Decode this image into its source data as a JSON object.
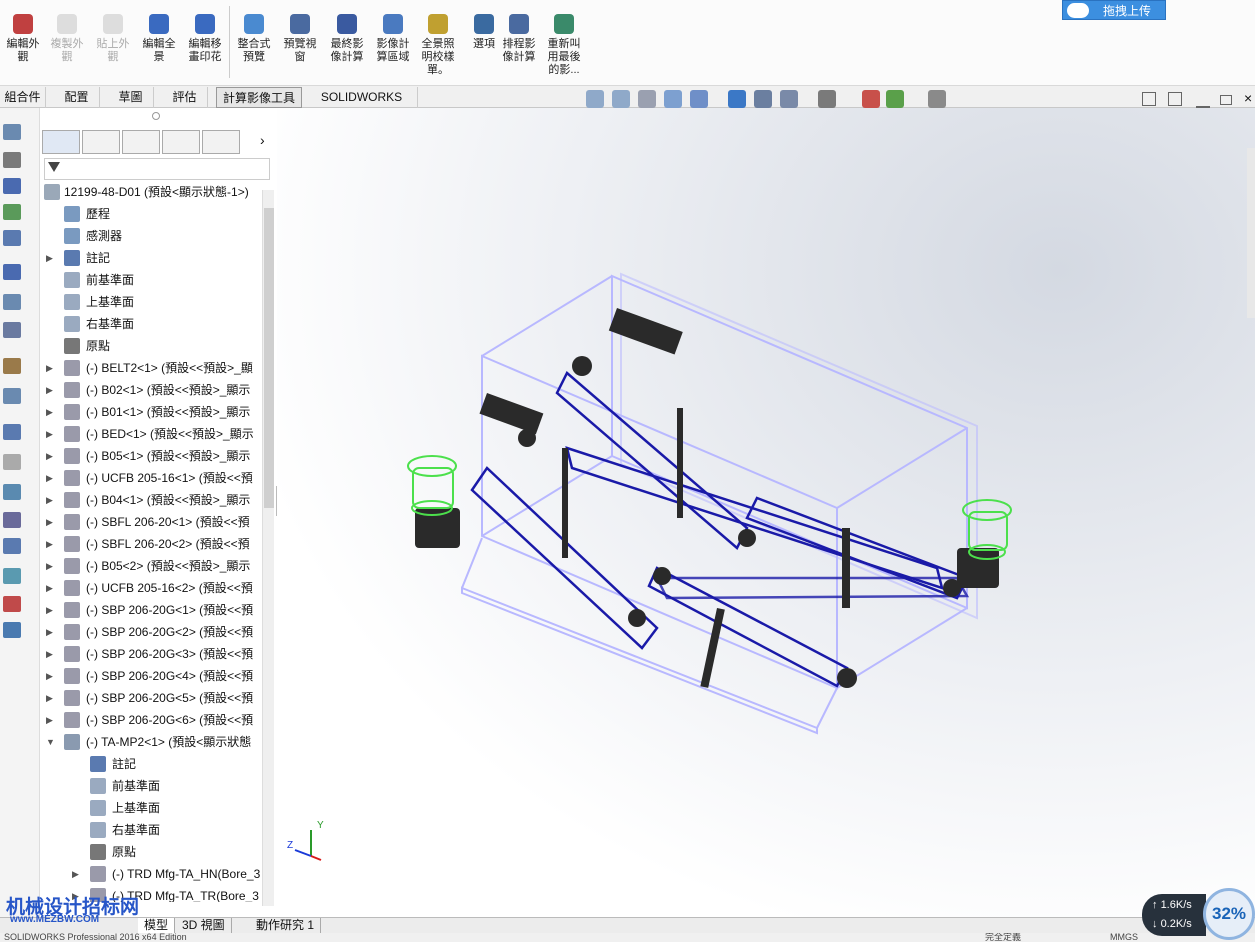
{
  "ribbon": {
    "buttons": [
      {
        "label": "編輯外觀",
        "icon": "edit-appearance-icon",
        "enabled": true
      },
      {
        "label": "複製外觀",
        "icon": "copy-appearance-icon",
        "enabled": false
      },
      {
        "label": "貼上外觀",
        "icon": "paste-appearance-icon",
        "enabled": false
      },
      {
        "label": "編輯全景",
        "icon": "edit-scene-icon",
        "enabled": true
      },
      {
        "label": "編輯移畫印花",
        "icon": "edit-decal-icon",
        "enabled": true
      },
      {
        "label": "整合式預覽",
        "icon": "integrated-preview-icon",
        "enabled": true
      },
      {
        "label": "預覽視窗",
        "icon": "preview-window-icon",
        "enabled": true
      },
      {
        "label": "最終影像計算",
        "icon": "final-render-icon",
        "enabled": true
      },
      {
        "label": "影像計算區域",
        "icon": "render-region-icon",
        "enabled": true
      },
      {
        "label": "全景照明校樣單。",
        "icon": "scene-illumination-proof-icon",
        "enabled": true
      },
      {
        "label": "選項",
        "icon": "options-icon",
        "enabled": true
      },
      {
        "label": "排程影像計算",
        "icon": "schedule-render-icon",
        "enabled": true
      },
      {
        "label": "重新叫用最後的影...",
        "icon": "recall-last-render-icon",
        "enabled": true
      }
    ],
    "upload_label": "拖拽上传"
  },
  "command_tabs": [
    "組合件",
    "配置",
    "草圖",
    "評估",
    "計算影像工具",
    "SOLIDWORKS MBD"
  ],
  "active_tab": "計算影像工具",
  "tree": {
    "root": "12199-48-D01 (預設<顯示狀態-1>)",
    "items": [
      {
        "label": "歷程",
        "icon": "history-folder-icon",
        "indent": 0,
        "expander": false
      },
      {
        "label": "感測器",
        "icon": "sensor-folder-icon",
        "indent": 0,
        "expander": false
      },
      {
        "label": "註記",
        "icon": "annotation-icon",
        "indent": 0,
        "expander": true
      },
      {
        "label": "前基準面",
        "icon": "plane-icon",
        "indent": 0,
        "expander": false
      },
      {
        "label": "上基準面",
        "icon": "plane-icon",
        "indent": 0,
        "expander": false
      },
      {
        "label": "右基準面",
        "icon": "plane-icon",
        "indent": 0,
        "expander": false
      },
      {
        "label": "原點",
        "icon": "origin-icon",
        "indent": 0,
        "expander": false
      },
      {
        "label": "(-) BELT2<1> (預設<<預設>_顯",
        "icon": "part-icon",
        "indent": 0,
        "expander": true
      },
      {
        "label": "(-) B02<1> (預設<<預設>_顯示",
        "icon": "part-icon",
        "indent": 0,
        "expander": true
      },
      {
        "label": "(-) B01<1> (預設<<預設>_顯示",
        "icon": "part-icon",
        "indent": 0,
        "expander": true
      },
      {
        "label": "(-) BED<1> (預設<<預設>_顯示",
        "icon": "part-icon",
        "indent": 0,
        "expander": true
      },
      {
        "label": "(-) B05<1> (預設<<預設>_顯示",
        "icon": "part-icon",
        "indent": 0,
        "expander": true
      },
      {
        "label": "(-) UCFB 205-16<1> (預設<<預",
        "icon": "part-icon",
        "indent": 0,
        "expander": true
      },
      {
        "label": "(-) B04<1> (預設<<預設>_顯示",
        "icon": "part-icon",
        "indent": 0,
        "expander": true
      },
      {
        "label": "(-) SBFL 206-20<1> (預設<<預",
        "icon": "part-icon",
        "indent": 0,
        "expander": true
      },
      {
        "label": "(-) SBFL 206-20<2> (預設<<預",
        "icon": "part-icon",
        "indent": 0,
        "expander": true
      },
      {
        "label": "(-) B05<2> (預設<<預設>_顯示",
        "icon": "part-icon",
        "indent": 0,
        "expander": true
      },
      {
        "label": "(-) UCFB 205-16<2> (預設<<預",
        "icon": "part-icon",
        "indent": 0,
        "expander": true
      },
      {
        "label": "(-) SBP 206-20G<1> (預設<<預",
        "icon": "part-icon",
        "indent": 0,
        "expander": true
      },
      {
        "label": "(-) SBP 206-20G<2> (預設<<預",
        "icon": "part-icon",
        "indent": 0,
        "expander": true
      },
      {
        "label": "(-) SBP 206-20G<3> (預設<<預",
        "icon": "part-icon",
        "indent": 0,
        "expander": true
      },
      {
        "label": "(-) SBP 206-20G<4> (預設<<預",
        "icon": "part-icon",
        "indent": 0,
        "expander": true
      },
      {
        "label": "(-) SBP 206-20G<5> (預設<<預",
        "icon": "part-icon",
        "indent": 0,
        "expander": true
      },
      {
        "label": "(-) SBP 206-20G<6> (預設<<預",
        "icon": "part-icon",
        "indent": 0,
        "expander": true
      },
      {
        "label": "(-) TA-MP2<1> (預設<顯示狀態",
        "icon": "assembly-icon",
        "indent": 0,
        "expander": true,
        "expanded": true
      },
      {
        "label": "註記",
        "icon": "annotation-icon",
        "indent": 1,
        "expander": false
      },
      {
        "label": "前基準面",
        "icon": "plane-icon",
        "indent": 1,
        "expander": false
      },
      {
        "label": "上基準面",
        "icon": "plane-icon",
        "indent": 1,
        "expander": false
      },
      {
        "label": "右基準面",
        "icon": "plane-icon",
        "indent": 1,
        "expander": false
      },
      {
        "label": "原點",
        "icon": "origin-icon",
        "indent": 1,
        "expander": false
      },
      {
        "label": "(-) TRD Mfg-TA_HN(Bore_3",
        "icon": "part-icon",
        "indent": 1,
        "expander": true
      },
      {
        "label": "(-) TRD Mfg-TA_TR(Bore_3",
        "icon": "part-icon",
        "indent": 1,
        "expander": true
      }
    ]
  },
  "bottom_tabs": [
    "模型",
    "3D 視圖",
    "動作研究 1"
  ],
  "active_bottom_tab": "模型",
  "status_bar": {
    "left": "SOLIDWORKS Professional 2016 x64 Edition",
    "center": "完全定義",
    "right": "MMGS"
  },
  "watermark": {
    "line1": "机械设计招标网",
    "line2": "www.MEZBW.COM"
  },
  "net_widget": {
    "up": "1.6K/s",
    "down": "0.2K/s",
    "percent": "32%"
  },
  "colors": {
    "accent": "#3c8fe0",
    "frame": "#b8b8ff",
    "conveyor": "#1a1aa8",
    "motor_highlight": "#4ce04c"
  }
}
